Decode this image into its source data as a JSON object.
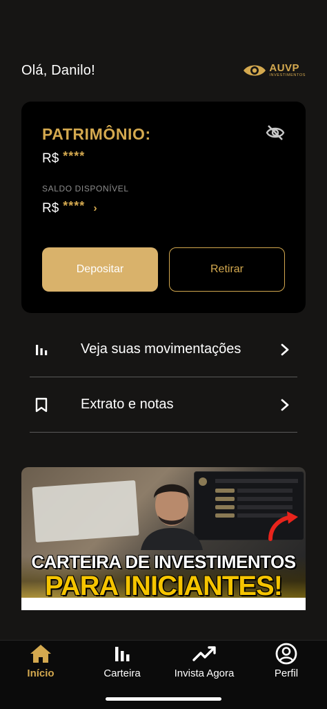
{
  "header": {
    "greeting": "Olá, Danilo!",
    "logo_brand": "AUVP",
    "logo_sub": "INVESTIMENTOS"
  },
  "card": {
    "title": "PATRIMÔNIO:",
    "currency": "R$",
    "masked_value": "****",
    "saldo_label": "SALDO DISPONÍVEL",
    "saldo_currency": "R$",
    "saldo_masked": "****",
    "deposit_label": "Depositar",
    "withdraw_label": "Retirar"
  },
  "menu": {
    "items": [
      {
        "label": "Veja suas movimentações",
        "icon": "bar-chart-icon"
      },
      {
        "label": "Extrato e notas",
        "icon": "bookmark-icon"
      }
    ]
  },
  "banner": {
    "line1": "CARTEIRA DE INVESTIMENTOS",
    "line2": "PARA INICIANTES!"
  },
  "tabbar": {
    "tabs": [
      {
        "label": "Início",
        "icon": "home-icon",
        "active": true
      },
      {
        "label": "Carteira",
        "icon": "bar-chart-icon",
        "active": false
      },
      {
        "label": "Invista Agora",
        "icon": "trend-line-icon",
        "active": false
      },
      {
        "label": "Perfil",
        "icon": "profile-icon",
        "active": false
      }
    ]
  },
  "colors": {
    "background": "#161514",
    "card": "#000000",
    "accent_gold": "#d4a94f",
    "deposit_button": "#d9b26b"
  }
}
